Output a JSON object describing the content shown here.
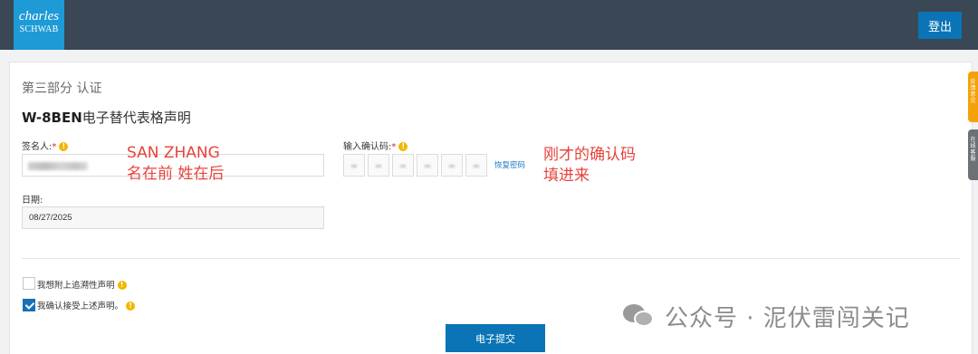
{
  "header": {
    "logo_line1": "charles",
    "logo_line2": "SCHWAB",
    "logout_label": "登出"
  },
  "section_title": "第三部分 认证",
  "form_title_bold": "W-8BEN",
  "form_title_rest": "电子替代表格声明",
  "signer": {
    "label": "签名人:",
    "required_mark": "*",
    "info_icon": "info-icon"
  },
  "date": {
    "label": "日期:",
    "value": "08/27/2025"
  },
  "confirmation_code": {
    "label": "输入确认码:",
    "required_mark": "*",
    "restore_link": "恢复密码",
    "box_count": 6
  },
  "annotations": {
    "name_line1": "SAN ZHANG",
    "name_line2": "名在前 姓在后",
    "code_line1": "刚才的确认码",
    "code_line2": "填进来"
  },
  "checkboxes": [
    {
      "label": "我想附上追溯性声明",
      "checked": false
    },
    {
      "label": "我确认接受上述声明。",
      "checked": true
    }
  ],
  "submit_label": "电子提交",
  "side_tabs": [
    {
      "label": "反馈意见",
      "color": "#f5a20a"
    },
    {
      "label": "在线客服",
      "color": "#6b7176"
    }
  ],
  "watermark": {
    "text": "公众号 · 泥伏雷闯关记",
    "icon": "wechat-icon"
  },
  "colors": {
    "topbar": "#3a4754",
    "brand": "#1e9ad6",
    "primary_button": "#0a74b6",
    "annotation": "#e8433c",
    "info": "#f2b600"
  }
}
